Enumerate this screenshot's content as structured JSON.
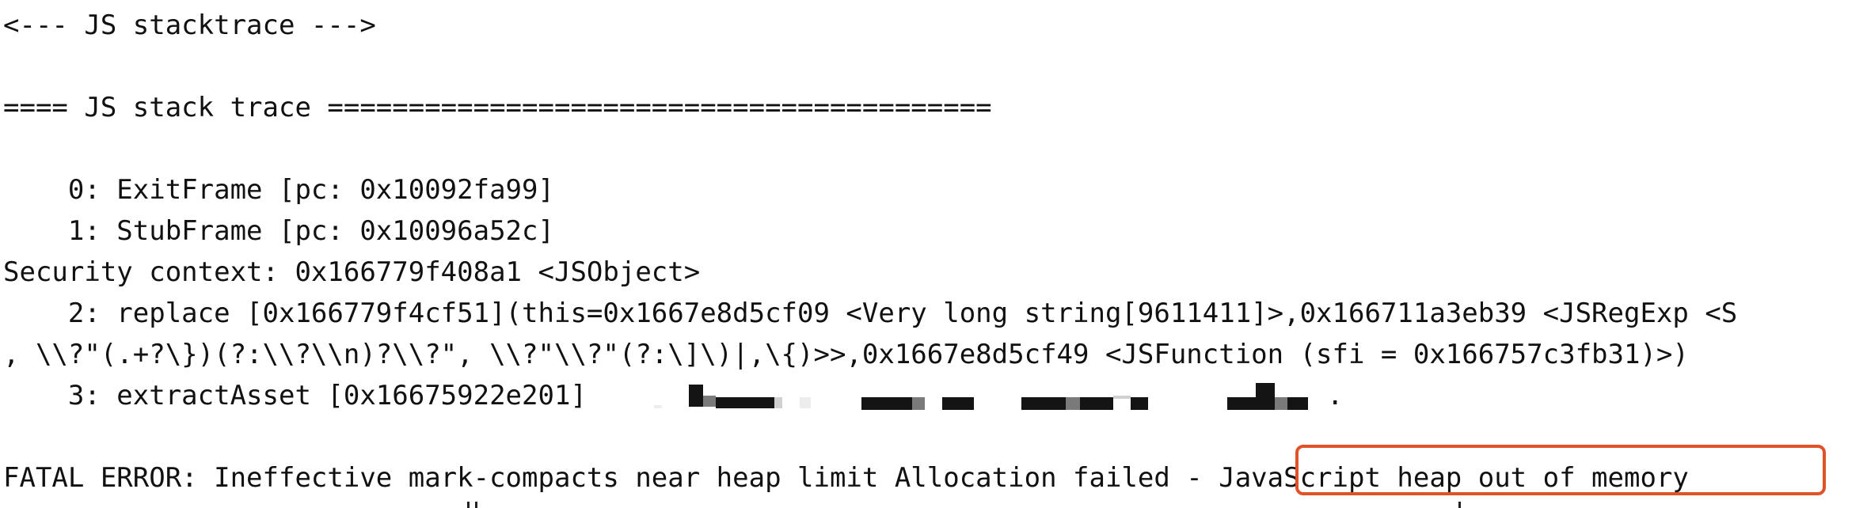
{
  "terminal": {
    "lines": [
      "<--- JS stacktrace --->",
      "==== JS stack trace =========================================",
      "    0: ExitFrame [pc: 0x10092fa99]",
      "    1: StubFrame [pc: 0x10096a52c]",
      "Security context: 0x166779f408a1 <JSObject>",
      "    2: replace [0x166779f4cf51](this=0x1667e8d5cf09 <Very long string[9611411]>,0x166711a3eb39 <JSRegExp <S",
      ", \\\\?\"(.+?\\})(?:\\\\?\\\\n)?\\\\?\", \\\\?\"\\\\?\"(?:\\]\\)|,\\{)>>,0x1667e8d5cf49 <JSFunction (sfi = 0x166757c3fb31)>)",
      "    3: extractAsset [0x16675922e201]",
      "FATAL ERROR: Ineffective mark-compacts near heap limit Allocation failed - JavaScript heap out of memory"
    ],
    "highlighted_text": "JavaScript heap out of memory",
    "redaction_trailing_mark": ".",
    "highlight_color": "#e0522a"
  }
}
